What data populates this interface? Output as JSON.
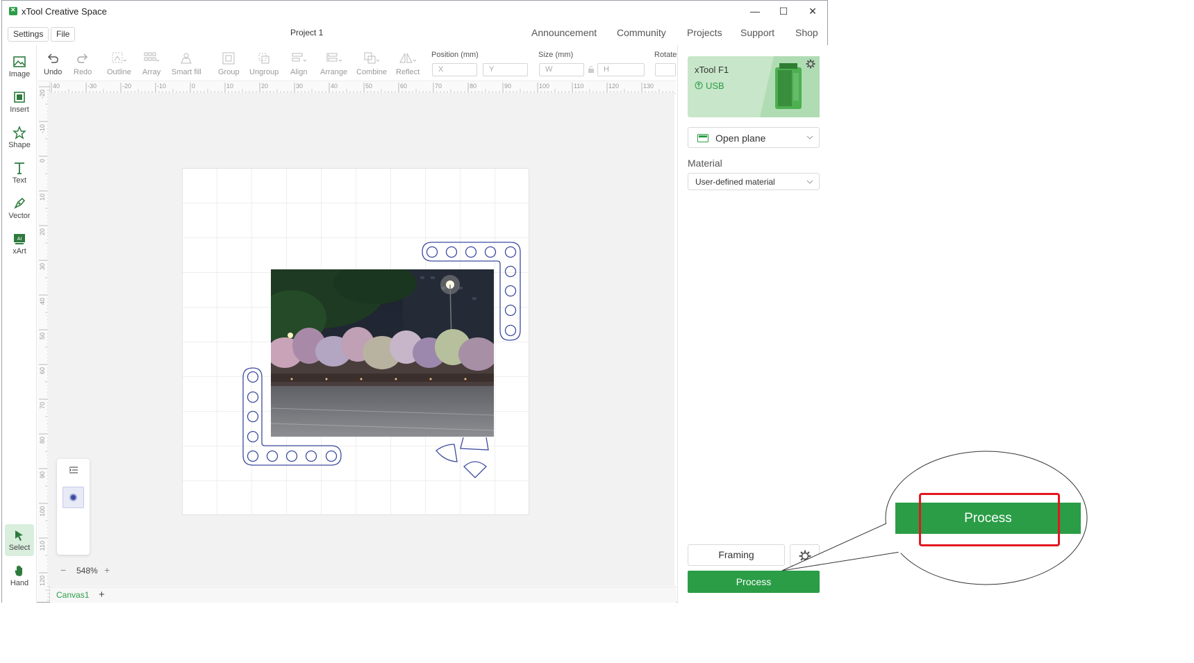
{
  "app": {
    "title": "xTool Creative Space",
    "project_title": "Project 1"
  },
  "window_controls": {
    "minimize": "—",
    "maximize": "☐",
    "close": "✕"
  },
  "menu": {
    "settings": "Settings",
    "file": "File"
  },
  "topnav": [
    "Announcement",
    "Community",
    "Projects",
    "Support",
    "Shop"
  ],
  "left_tools": [
    {
      "label": "Image",
      "icon": "image-icon"
    },
    {
      "label": "Insert",
      "icon": "insert-icon"
    },
    {
      "label": "Shape",
      "icon": "shape-icon"
    },
    {
      "label": "Text",
      "icon": "text-icon"
    },
    {
      "label": "Vector",
      "icon": "vector-icon"
    },
    {
      "label": "xArt",
      "icon": "xart-icon"
    }
  ],
  "bottom_left_tools": [
    {
      "label": "Select",
      "icon": "select-icon",
      "active": true
    },
    {
      "label": "Hand",
      "icon": "hand-icon",
      "active": false
    }
  ],
  "toolbar": {
    "undo": "Undo",
    "redo": "Redo",
    "outline": "Outline",
    "array": "Array",
    "smart_fill": "Smart fill",
    "group": "Group",
    "ungroup": "Ungroup",
    "align": "Align",
    "arrange": "Arrange",
    "combine": "Combine",
    "reflect": "Reflect",
    "position_label": "Position (mm)",
    "x_placeholder": "X",
    "y_placeholder": "Y",
    "size_label": "Size (mm)",
    "w_placeholder": "W",
    "h_placeholder": "H",
    "rotate_label": "Rotate"
  },
  "ruler": {
    "h_ticks": [
      "40",
      "-30",
      "-20",
      "-10",
      "0",
      "10",
      "20",
      "30",
      "40",
      "50",
      "60",
      "70",
      "80",
      "90",
      "100",
      "110",
      "120",
      "130"
    ],
    "v_ticks": [
      "-20",
      "-10",
      "0",
      "10",
      "20",
      "30",
      "40",
      "50",
      "60",
      "70",
      "80",
      "90",
      "100",
      "110",
      "120"
    ]
  },
  "device": {
    "name": "xTool F1",
    "connection": "USB"
  },
  "plane": {
    "label": "Open plane"
  },
  "material": {
    "heading": "Material",
    "value": "User-defined material"
  },
  "actions": {
    "framing": "Framing",
    "process": "Process"
  },
  "zoom": {
    "minus": "−",
    "value": "548%",
    "plus": "+"
  },
  "canvas_tabs": {
    "active": "Canvas1",
    "add": "+"
  },
  "callout": {
    "button": "Process"
  },
  "colors": {
    "brand_green": "#2a9d46",
    "callout_red": "#e3161f",
    "shape_stroke": "#3b4a9e"
  }
}
